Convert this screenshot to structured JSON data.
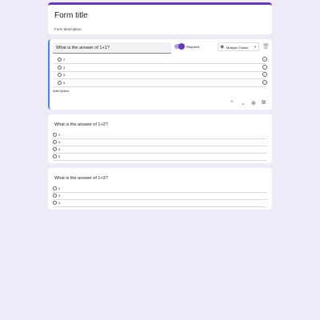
{
  "form": {
    "title": "Form title",
    "description": "Form description"
  },
  "question1": {
    "text": "What is the answer of 1+1?",
    "required_label": "Required",
    "type_label": "Multiple Choice",
    "options": [
      "2",
      "3",
      "4",
      "5"
    ],
    "add_option_label": "Add Option"
  },
  "question2": {
    "text": "What is the answer of 1+2?",
    "options": [
      "2",
      "3",
      "4",
      "5"
    ]
  },
  "question3": {
    "text": "What is the answer of 1+3?",
    "options": [
      "2",
      "3",
      "4"
    ]
  },
  "colors": {
    "background": "#eeeaf8",
    "accent": "#673ab7",
    "active_border": "#4285f4"
  }
}
